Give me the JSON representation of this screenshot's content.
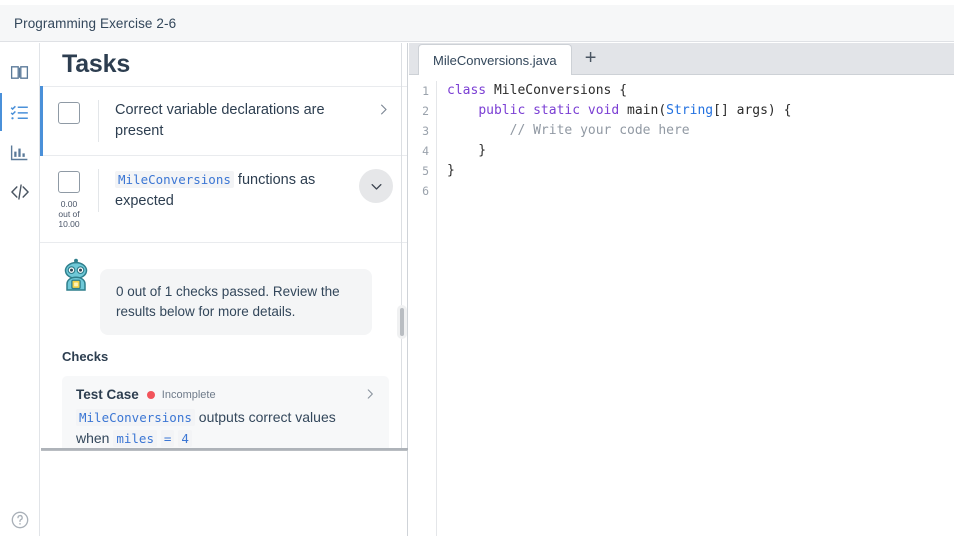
{
  "header": {
    "title": "Programming Exercise 2-6"
  },
  "rail": {
    "items": [
      {
        "name": "book-icon",
        "label": "Instructions",
        "active": false
      },
      {
        "name": "checklist-icon",
        "label": "Tasks",
        "active": true
      },
      {
        "name": "chart-icon",
        "label": "Progress",
        "active": false
      },
      {
        "name": "code-icon",
        "label": "Code",
        "active": false
      }
    ],
    "help_label": "Help"
  },
  "tasks": {
    "heading": "Tasks",
    "items": [
      {
        "title_plain": "Correct variable declarations are present",
        "checked": false,
        "score": null,
        "affordance": "chevron-right"
      },
      {
        "title_prefix_code": "MileConversions",
        "title_rest": "functions as expected",
        "checked": false,
        "score": "0.00\nout of\n10.00",
        "score_value": "0.00",
        "score_total": "10.00",
        "affordance": "chevron-down"
      }
    ]
  },
  "bot": {
    "avatar": "robot-avatar",
    "message": "0 out of 1 checks passed. Review the results below for more details."
  },
  "checks": {
    "heading": "Checks",
    "items": [
      {
        "name": "Test Case",
        "status": "Incomplete",
        "status_color": "#f2545b",
        "desc_code_1": "MileConversions",
        "desc_mid": " outputs correct values when ",
        "desc_code_2": "miles",
        "desc_eq": "=",
        "desc_code_3": "4"
      }
    ]
  },
  "editor": {
    "tabs": [
      {
        "label": "MileConversions.java",
        "active": true
      }
    ],
    "new_tab_label": "+",
    "line_numbers": [
      "1",
      "2",
      "3",
      "4",
      "5",
      "6"
    ],
    "code_lines": [
      "class MileConversions {",
      "    public static void main(String[] args) {",
      "        // Write your code here",
      "    }",
      "}",
      ""
    ]
  },
  "colors": {
    "accent_blue": "#4a90d9",
    "keyword_purple": "#7b3fd4",
    "type_blue": "#2271e0",
    "comment_gray": "#9199a3",
    "status_red": "#f2545b",
    "code_badge_blue": "#3b76d4"
  }
}
